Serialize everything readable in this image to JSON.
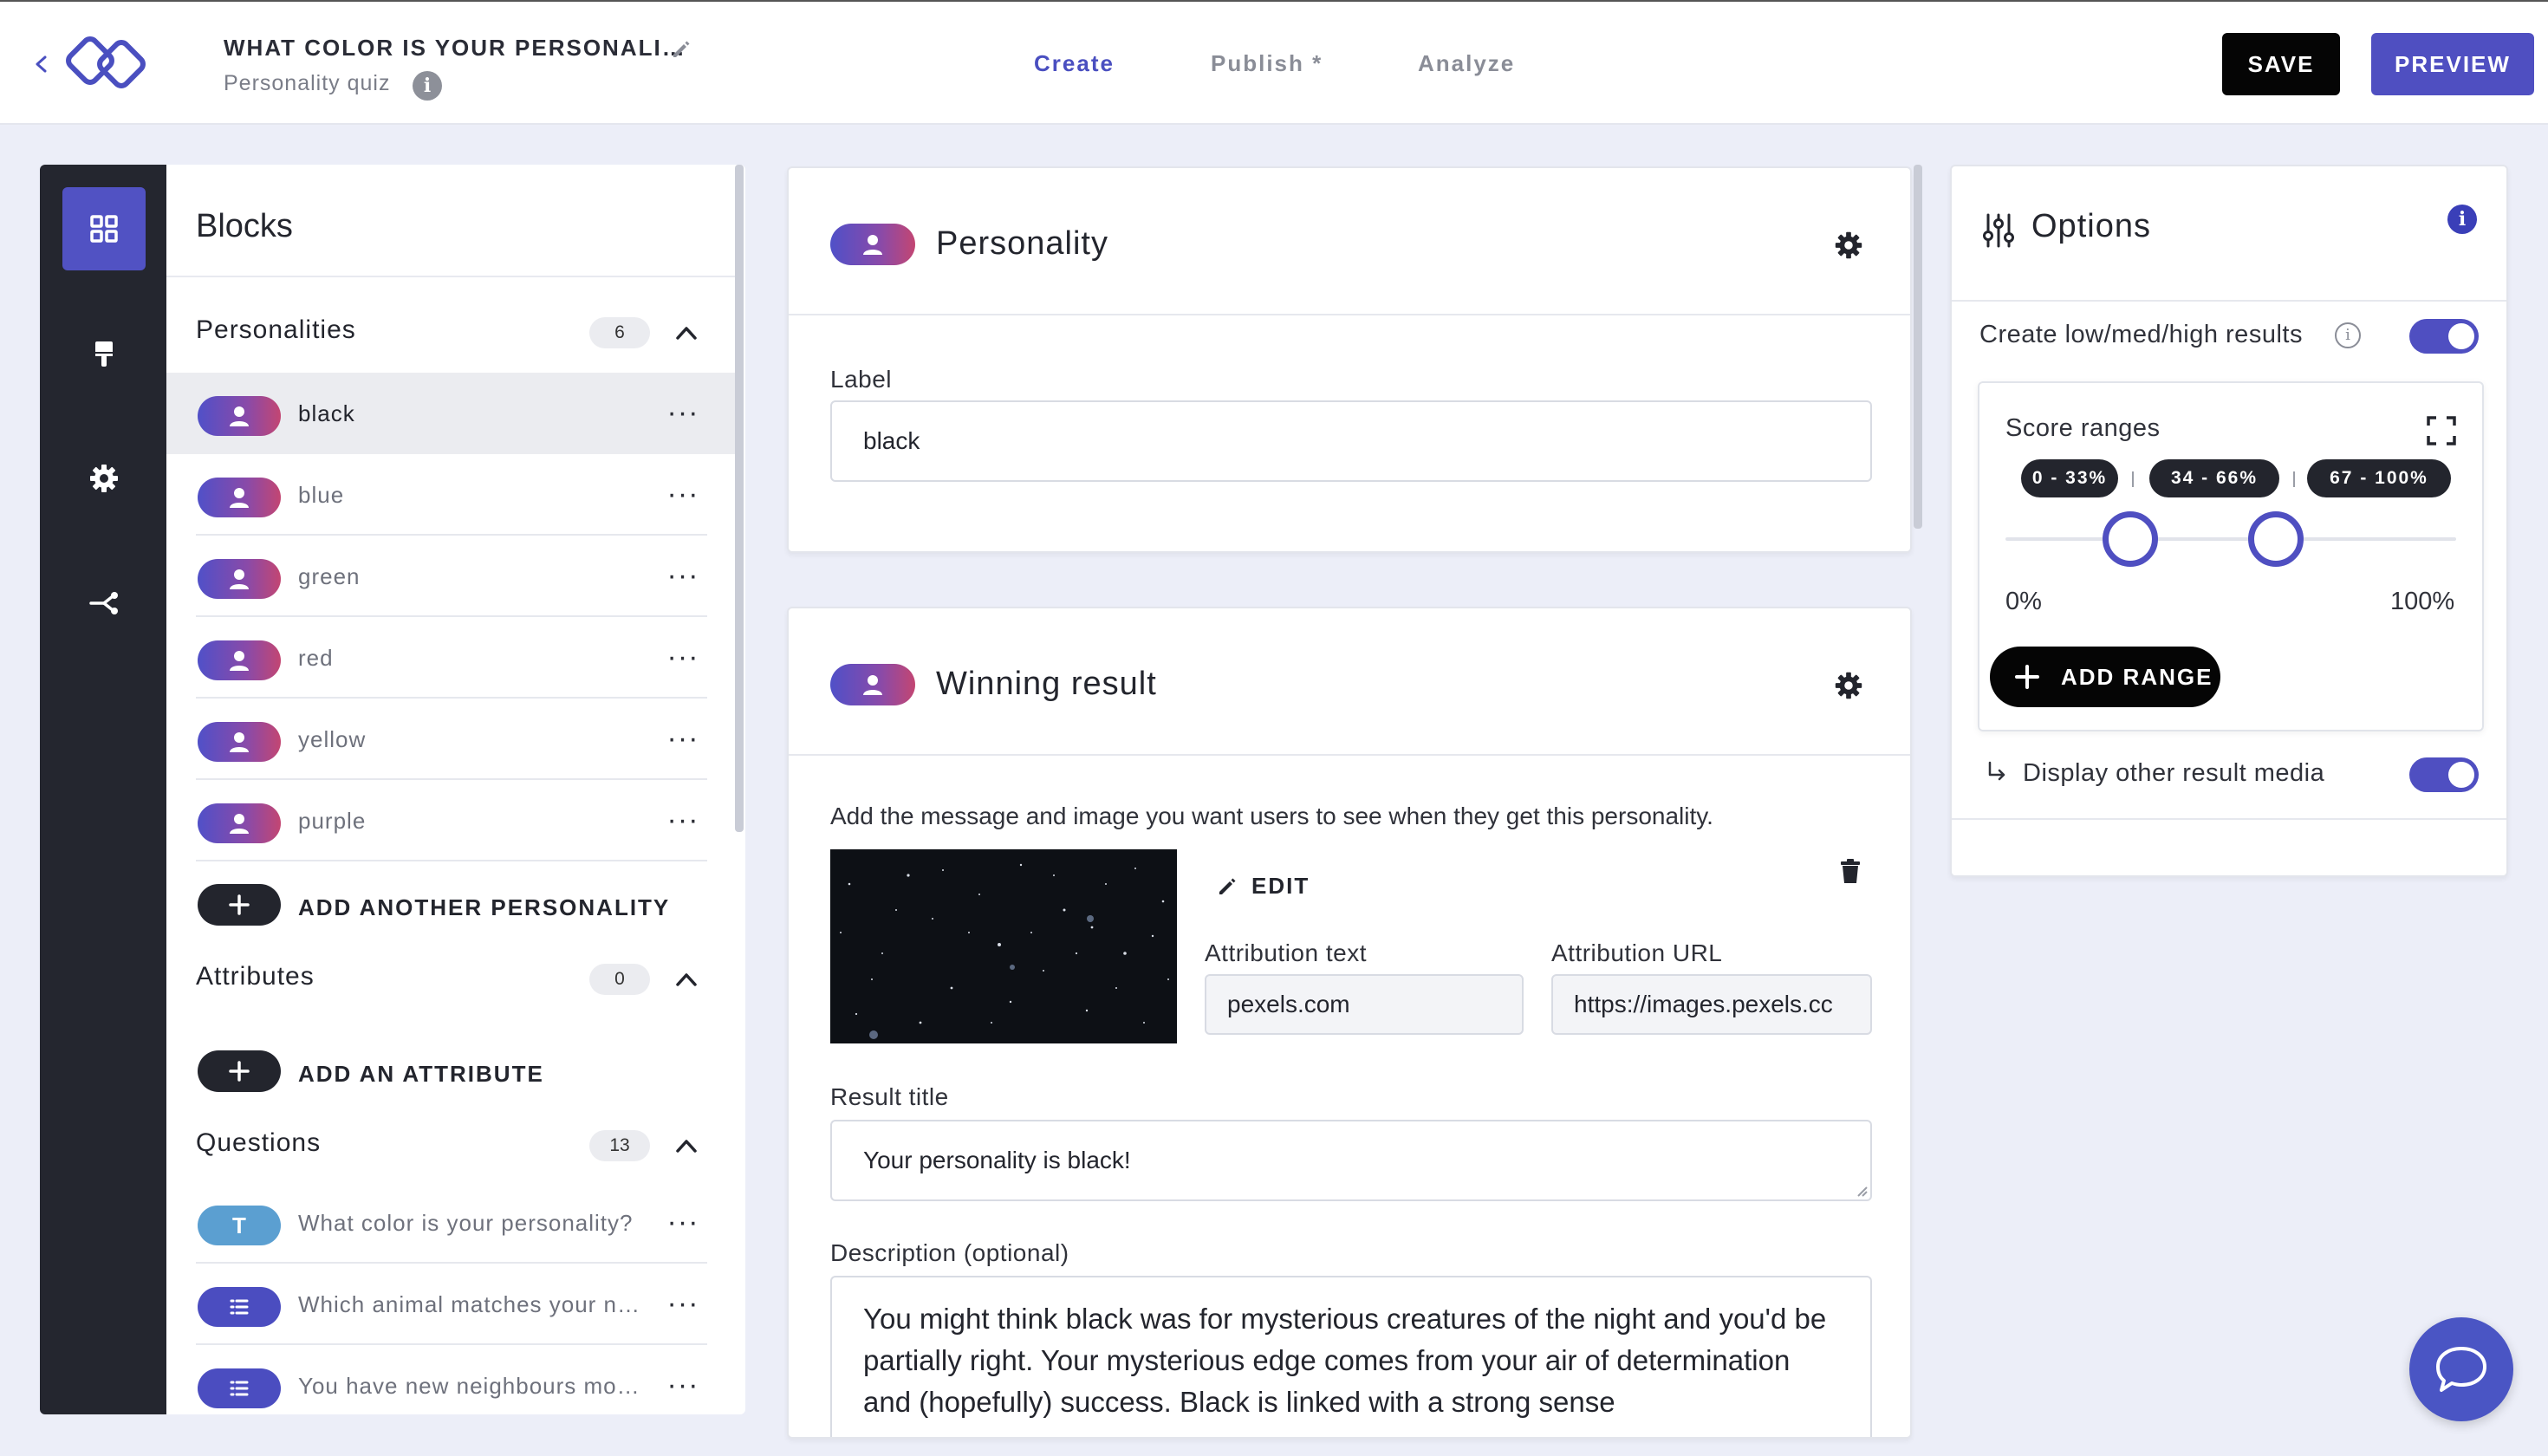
{
  "header": {
    "quiz_title": "WHAT COLOR IS YOUR PERSONALI…",
    "quiz_subtitle": "Personality quiz",
    "tabs": [
      {
        "label": "Create",
        "active": true
      },
      {
        "label": "Publish *",
        "active": false
      },
      {
        "label": "Analyze",
        "active": false
      }
    ],
    "save_label": "SAVE",
    "preview_label": "PREVIEW"
  },
  "rail": {
    "items": [
      {
        "icon": "blocks-grid-icon",
        "active": true
      },
      {
        "icon": "paintbrush-icon",
        "active": false
      },
      {
        "icon": "gear-icon",
        "active": false
      },
      {
        "icon": "share-branch-icon",
        "active": false
      }
    ]
  },
  "blocks": {
    "title": "Blocks",
    "personalities": {
      "label": "Personalities",
      "count": "6",
      "items": [
        {
          "label": "black",
          "selected": true
        },
        {
          "label": "blue",
          "selected": false
        },
        {
          "label": "green",
          "selected": false
        },
        {
          "label": "red",
          "selected": false
        },
        {
          "label": "yellow",
          "selected": false
        },
        {
          "label": "purple",
          "selected": false
        }
      ],
      "add_label": "ADD ANOTHER PERSONALITY"
    },
    "attributes": {
      "label": "Attributes",
      "count": "0",
      "add_label": "ADD AN ATTRIBUTE"
    },
    "questions": {
      "label": "Questions",
      "count": "13",
      "items": [
        {
          "type": "T",
          "label": "What color is your personality?"
        },
        {
          "type": "list",
          "label": "Which animal matches your n…"
        },
        {
          "type": "list",
          "label": "You have new neighbours mo…"
        }
      ]
    },
    "more_label": "···"
  },
  "personality_card": {
    "title": "Personality",
    "label_caption": "Label",
    "label_value": "black"
  },
  "result_card": {
    "title": "Winning result",
    "description": "Add the message and image you want users to see when they get this personality.",
    "edit_label": "EDIT",
    "attribution_text_caption": "Attribution text",
    "attribution_text_value": "pexels.com",
    "attribution_url_caption": "Attribution URL",
    "attribution_url_value": "https://images.pexels.cc",
    "result_title_caption": "Result title",
    "result_title_value": "Your personality is black!",
    "desc_caption": "Description (optional)",
    "desc_value": "You might think black was for mysterious creatures of the night and you'd be partially right. Your mysterious edge comes from your air of determination and (hopefully) success. Black is linked with a strong sense"
  },
  "options": {
    "title": "Options",
    "low_med_high_label": "Create low/med/high results",
    "low_med_high_on": true,
    "score_ranges_label": "Score ranges",
    "ranges": [
      "0 - 33%",
      "34 - 66%",
      "67 - 100%"
    ],
    "slider_handles_percent": [
      33,
      66
    ],
    "min_label": "0%",
    "max_label": "100%",
    "add_range_label": "ADD RANGE",
    "display_media_label": "Display other result media",
    "display_media_on": true
  },
  "colors": {
    "accent": "#4f4fc1",
    "rail_bg": "#24262f",
    "page_bg": "#eceef8",
    "pill_gradient_start": "#5050c8",
    "pill_gradient_end": "#c34672"
  }
}
